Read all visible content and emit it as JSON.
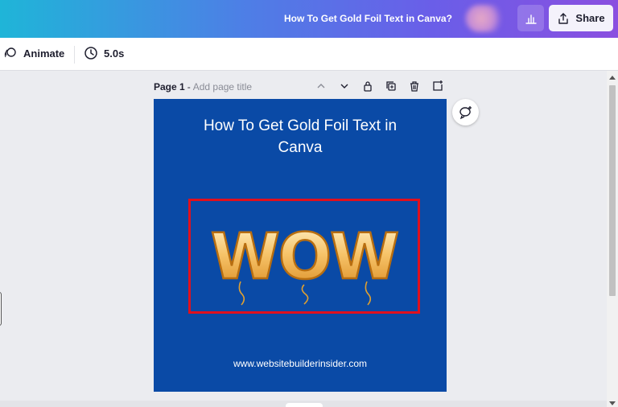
{
  "header": {
    "doc_title": "How To Get Gold Foil Text in Canva?",
    "share_label": "Share",
    "icons": [
      "insights-icon",
      "share-upload-icon"
    ]
  },
  "toolbar": {
    "animate_label": "Animate",
    "duration_label": "5.0s",
    "icons": [
      "animate-icon",
      "clock-icon"
    ]
  },
  "page": {
    "page_label": "Page 1",
    "separator": "-",
    "title_placeholder": "Add page title",
    "tool_icons": [
      "chevron-up-icon",
      "chevron-down-icon",
      "lock-icon",
      "duplicate-icon",
      "trash-icon",
      "add-page-icon"
    ]
  },
  "design": {
    "title_line1": "How To Get Gold Foil Text in",
    "title_line2": "Canva",
    "balloon_text": "WOW",
    "footer_url": "www.websitebuilderinsider.com",
    "colors": {
      "page_bg": "#0a4aa6",
      "frame": "#e0101d",
      "gold": "#f3b64a"
    }
  },
  "comment": {
    "icon": "add-comment-icon"
  }
}
